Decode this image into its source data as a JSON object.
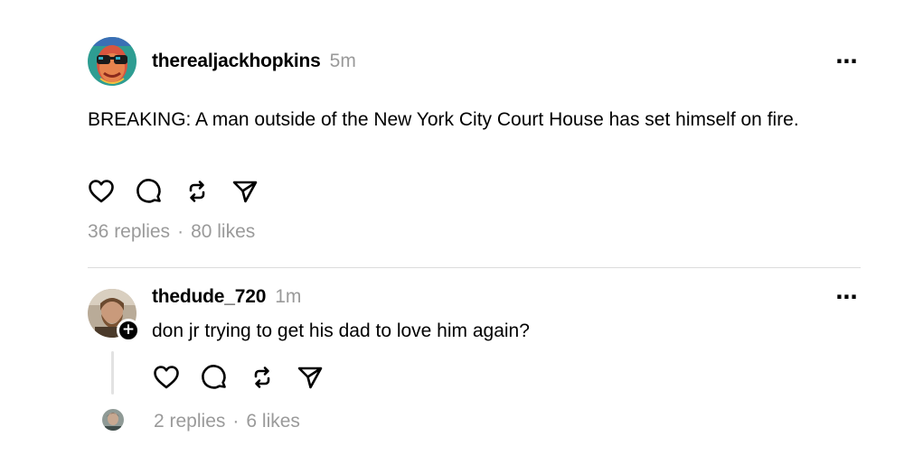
{
  "post": {
    "username": "therealjackhopkins",
    "time": "5m",
    "text": "BREAKING: A man outside of the New York City Court House has set himself on fire.",
    "replies": "36 replies",
    "separator": "·",
    "likes": "80 likes",
    "avatar_icon": "user-avatar-sunglasses",
    "more_icon": "ellipsis-icon",
    "more_glyph": "···"
  },
  "reply": {
    "username": "thedude_720",
    "time": "1m",
    "text": "don jr trying to get his dad to love him again?",
    "replies": "2 replies",
    "separator": "·",
    "likes": "6 likes",
    "avatar_icon": "user-avatar-bearded",
    "follow_glyph": "+",
    "more_glyph": "···"
  },
  "actions": [
    "heart-icon",
    "comment-icon",
    "repost-icon",
    "share-icon"
  ],
  "colors": {
    "text": "#000000",
    "muted": "#9a9a9a",
    "divider": "#dcdcdc"
  }
}
